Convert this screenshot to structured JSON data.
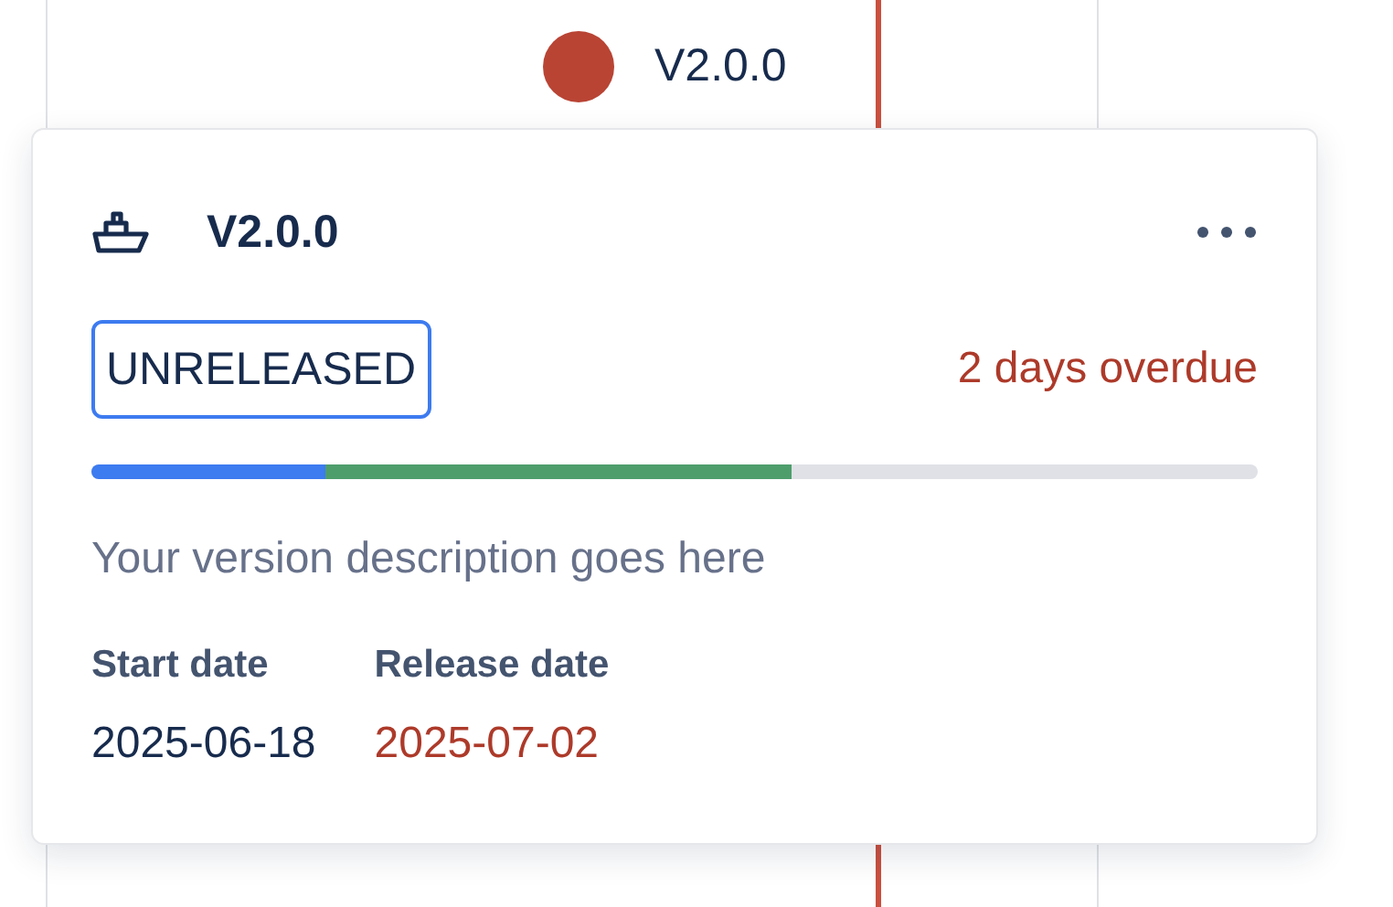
{
  "timeline_marker": {
    "label": "V2.0.0",
    "color": "#b94434"
  },
  "card": {
    "title": "V2.0.0",
    "status": "UNRELEASED",
    "overdue_text": "2 days overdue",
    "progress": [
      {
        "level": 0.2,
        "color": "#3d7bf0"
      },
      {
        "level": 0.4,
        "color": "#4e9e6c"
      }
    ],
    "description": "Your version description goes here",
    "dates": [
      {
        "label": "Start date",
        "value": "2025-06-18",
        "overdue": false
      },
      {
        "label": "Release date",
        "value": "2025-07-02",
        "overdue": true
      }
    ]
  }
}
